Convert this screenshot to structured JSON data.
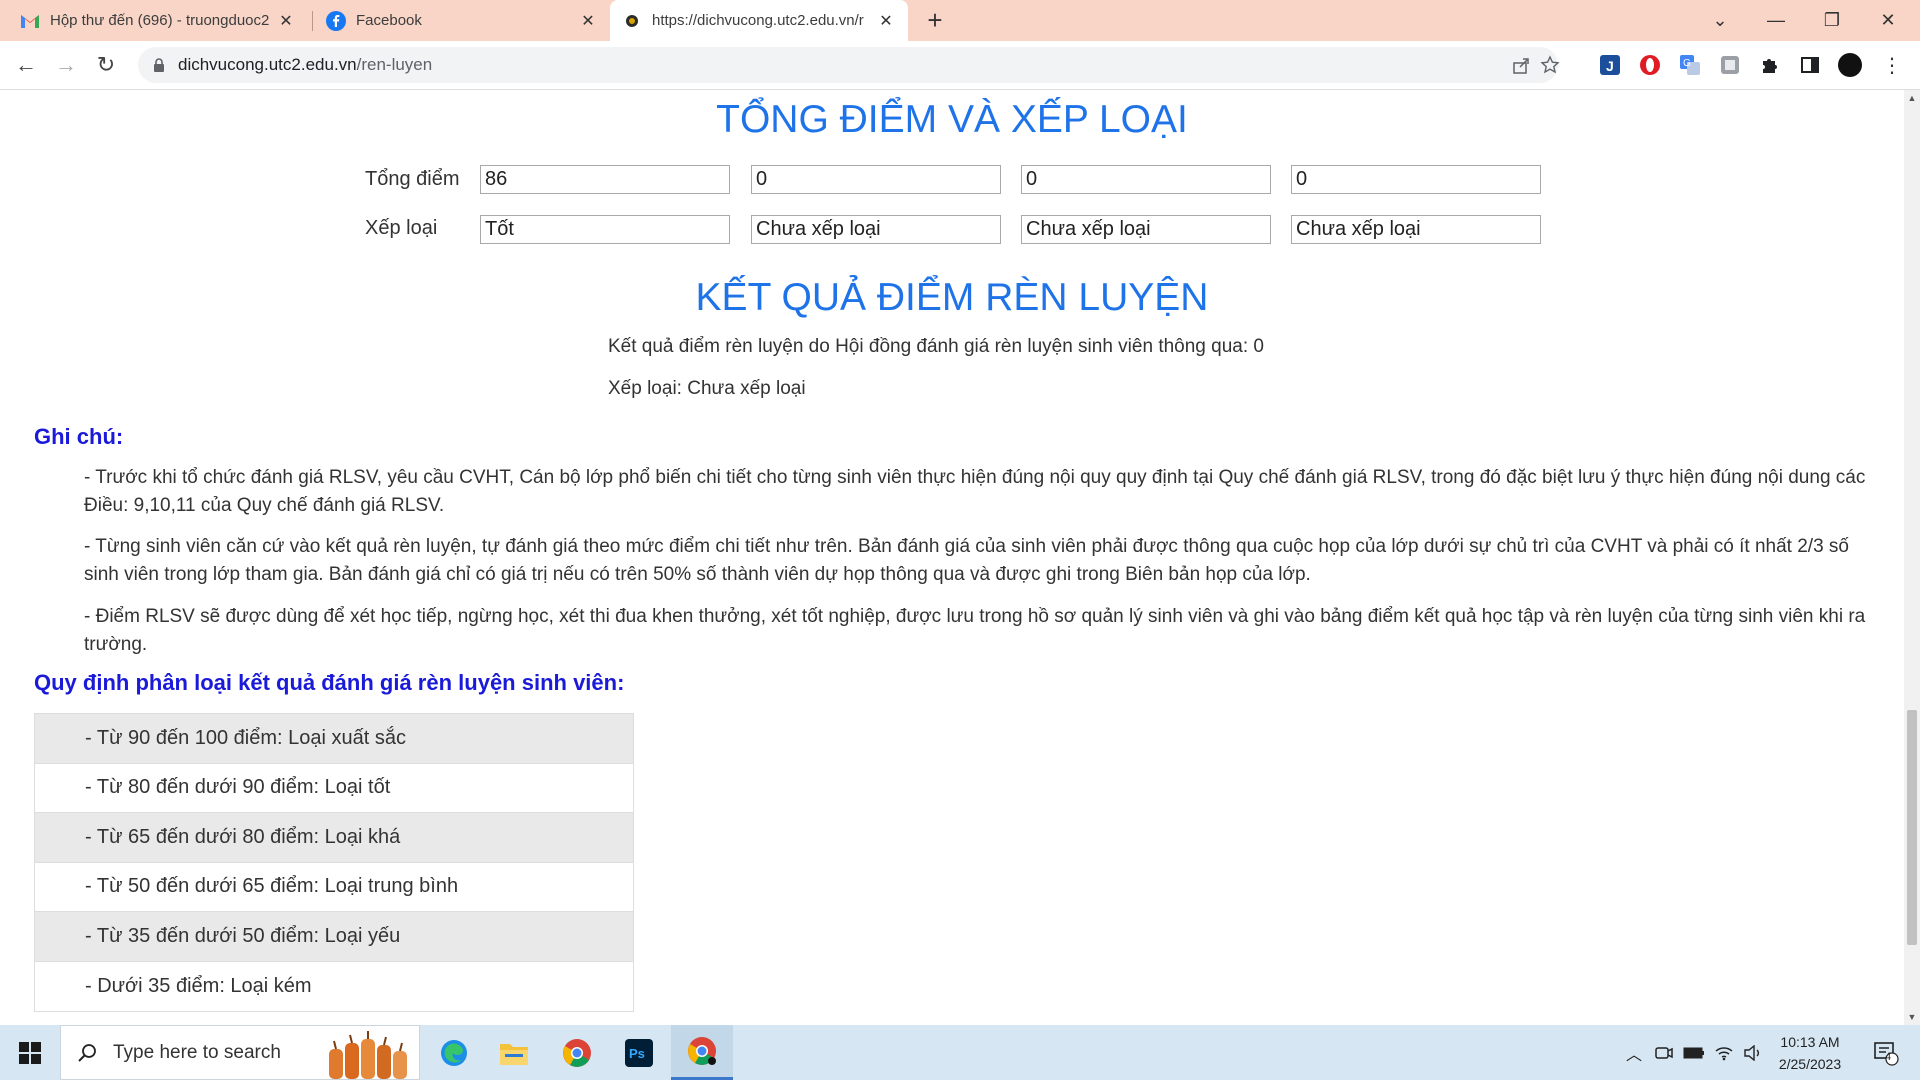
{
  "browser": {
    "tabs": [
      {
        "title": "Hộp thư đến (696) - truongduoc2",
        "icon": "gmail-icon"
      },
      {
        "title": "Facebook",
        "icon": "facebook-icon"
      },
      {
        "title": "https://dichvucong.utc2.edu.vn/r",
        "icon": "site-icon"
      }
    ],
    "url_host": "dichvucong.utc2.edu.vn",
    "url_path": "/ren-luyen"
  },
  "summary": {
    "title": "TỔNG ĐIỂM VÀ XẾP LOẠI",
    "total_label": "Tổng điểm",
    "rank_label": "Xếp loại",
    "totals": [
      "86",
      "0",
      "0",
      "0"
    ],
    "ranks": [
      "Tốt",
      "Chưa xếp loại",
      "Chưa xếp loại",
      "Chưa xếp loại"
    ]
  },
  "result": {
    "title": "KẾT QUẢ ĐIỂM RÈN LUYỆN",
    "council_text": "Kết quả điểm rèn luyện do Hội đồng đánh giá rèn luyện sinh viên thông qua: 0",
    "rank_text": "Xếp loại: Chưa xếp loại"
  },
  "notes": {
    "heading": "Ghi chú:",
    "items": [
      "- Trước khi tổ chức đánh giá RLSV, yêu cầu CVHT, Cán bộ lớp phổ biến chi tiết cho từng sinh viên thực hiện đúng nội quy quy định tại Quy chế đánh giá RLSV, trong đó đặc biệt lưu ý thực hiện đúng nội dung các Điều: 9,10,11 của Quy chế đánh giá RLSV.",
      "- Từng sinh viên căn cứ vào kết quả rèn luyện, tự đánh giá theo mức điểm chi tiết như trên. Bản đánh giá của sinh viên phải được thông qua cuộc họp của lớp dưới sự chủ trì của CVHT và phải có ít nhất 2/3 số sinh viên trong lớp tham gia. Bản đánh giá chỉ có giá trị nếu có trên 50% số thành viên dự họp thông qua và được ghi trong Biên bản họp của lớp.",
      "- Điểm RLSV sẽ được dùng để xét học tiếp, ngừng học, xét thi đua khen thưởng, xét tốt nghiệp, được lưu trong hồ sơ quản lý sinh viên và ghi vào bảng điểm kết quả học tập và rèn luyện của từng sinh viên khi ra trường."
    ]
  },
  "ranking": {
    "heading": "Quy định phân loại kết quả đánh giá rèn luyện sinh viên:",
    "rows": [
      "- Từ 90 đến 100 điểm: Loại xuất sắc",
      "- Từ 80 đến dưới 90 điểm: Loại tốt",
      "- Từ 65 đến dưới 80 điểm: Loại khá",
      "- Từ 50 đến dưới 65 điểm: Loại trung bình",
      "- Từ 35 đến dưới 50 điểm: Loại yếu",
      "- Dưới 35 điểm: Loại kém"
    ]
  },
  "taskbar": {
    "search_placeholder": "Type here to search",
    "time": "10:13 AM",
    "date": "2/25/2023",
    "notification_count": "4"
  },
  "colors": {
    "heading_blue": "#1e73e8",
    "note_blue": "#1a1ad8",
    "tabbar": "#f8d5c7"
  }
}
